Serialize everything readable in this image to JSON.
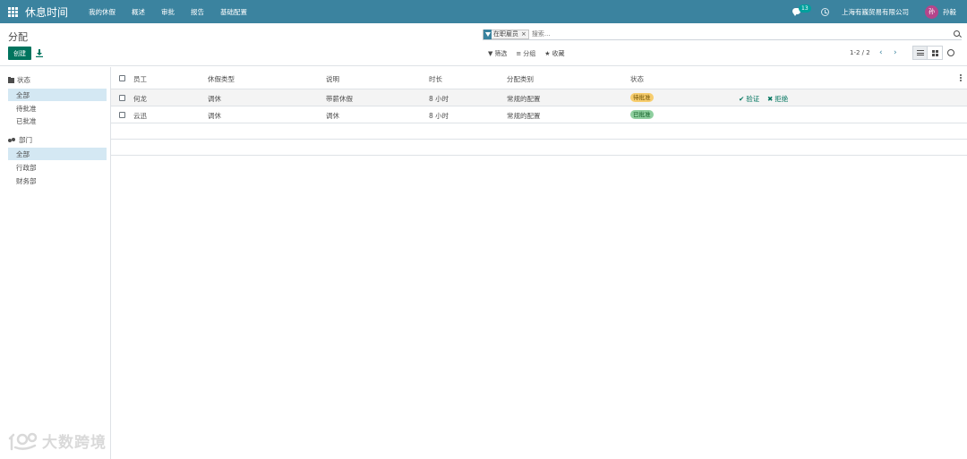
{
  "navbar": {
    "app_title": "休息时间",
    "menu": [
      "我的休假",
      "概述",
      "审批",
      "报告",
      "基础配置"
    ],
    "message_count": "13",
    "company": "上海有巍贸易有限公司",
    "user_initial": "孙",
    "user_name": "孙毅",
    "colors": {
      "bar": "#3b839f",
      "avatar": "#b4458b",
      "badge": "#00a09d"
    }
  },
  "control_panel": {
    "title": "分配",
    "create_label": "创建",
    "search": {
      "facet_value": "在职雇员",
      "placeholder": "搜索..."
    },
    "filter_label": "筛选",
    "group_label": "分组",
    "favorite_label": "收藏",
    "pager": "1-2 / 2"
  },
  "side_panel": {
    "groups": [
      {
        "title": "状态",
        "icon": "folder-icon",
        "items": [
          "全部",
          "待批准",
          "已批准"
        ],
        "active": "全部"
      },
      {
        "title": "部门",
        "icon": "users-icon",
        "items": [
          "全部",
          "行政部",
          "财务部"
        ],
        "active": "全部"
      }
    ]
  },
  "list": {
    "columns": [
      "员工",
      "休假类型",
      "说明",
      "时长",
      "分配类别",
      "状态"
    ],
    "rows": [
      {
        "employee": "何龙",
        "leave_type": "调休",
        "description": "带薪休假",
        "duration": "8 小时",
        "category": "常规的配置",
        "status": "待批准",
        "status_kind": "pending",
        "validate_label": "验证",
        "refuse_label": "拒绝"
      },
      {
        "employee": "云迅",
        "leave_type": "调休",
        "description": "调休",
        "duration": "8 小时",
        "category": "常规的配置",
        "status": "已批准",
        "status_kind": "approved"
      }
    ],
    "status_colors": {
      "pending": "#f7cd6e",
      "approved": "#8fcf9f"
    }
  },
  "watermark": {
    "text": "大数跨境"
  }
}
